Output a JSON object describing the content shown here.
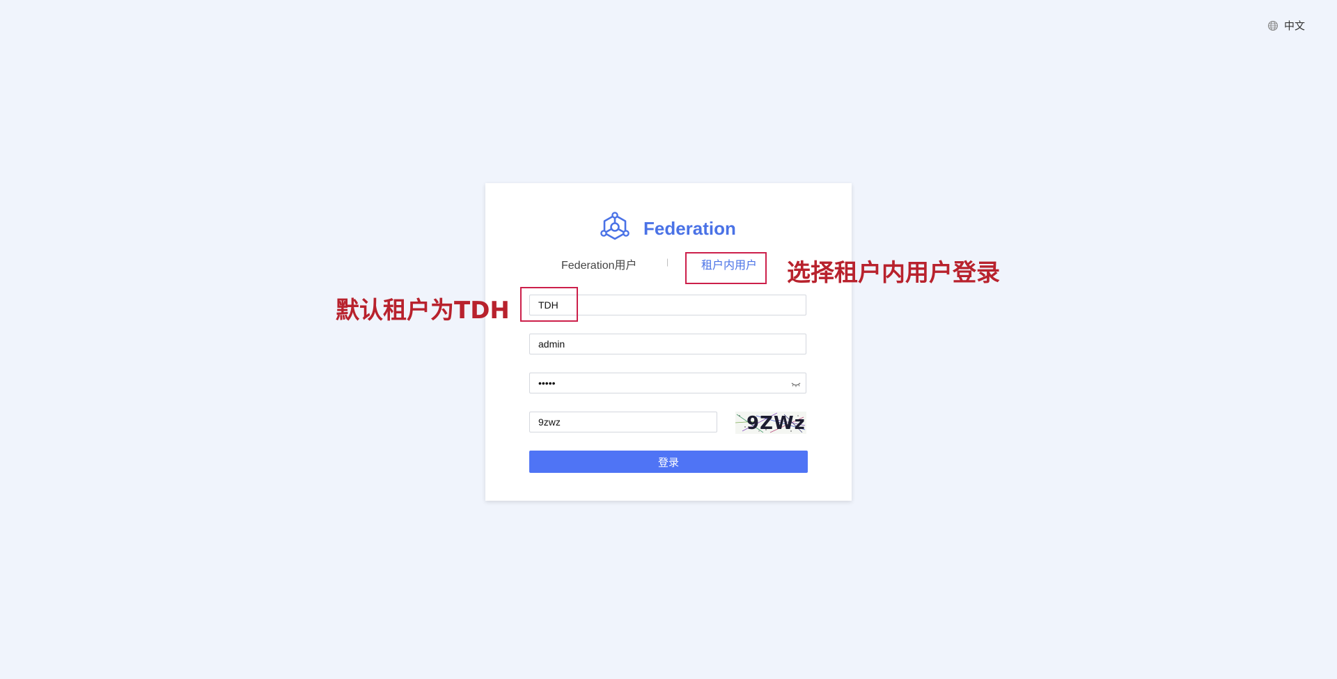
{
  "language": {
    "label": "中文",
    "icon": "globe-icon"
  },
  "brand": {
    "icon": "molecule-logo-icon",
    "title": "Federation",
    "color": "#4a72e6"
  },
  "tabs": {
    "federation_user": "Federation用户",
    "separator": "|",
    "tenant_user": "租户内用户",
    "active": "tenant_user"
  },
  "form": {
    "tenant_value": "TDH",
    "username_value": "admin",
    "password_value": "admin",
    "password_toggle_icon": "eye-closed-icon",
    "captcha_value": "9zwz",
    "captcha_image_text": "9ZWz",
    "login_label": "登录",
    "login_color": "#4f74f5"
  },
  "annotations": {
    "tab_note": "选择租户内用户登录",
    "tenant_note": "默认租户为TDH",
    "color": "#b8222d"
  }
}
